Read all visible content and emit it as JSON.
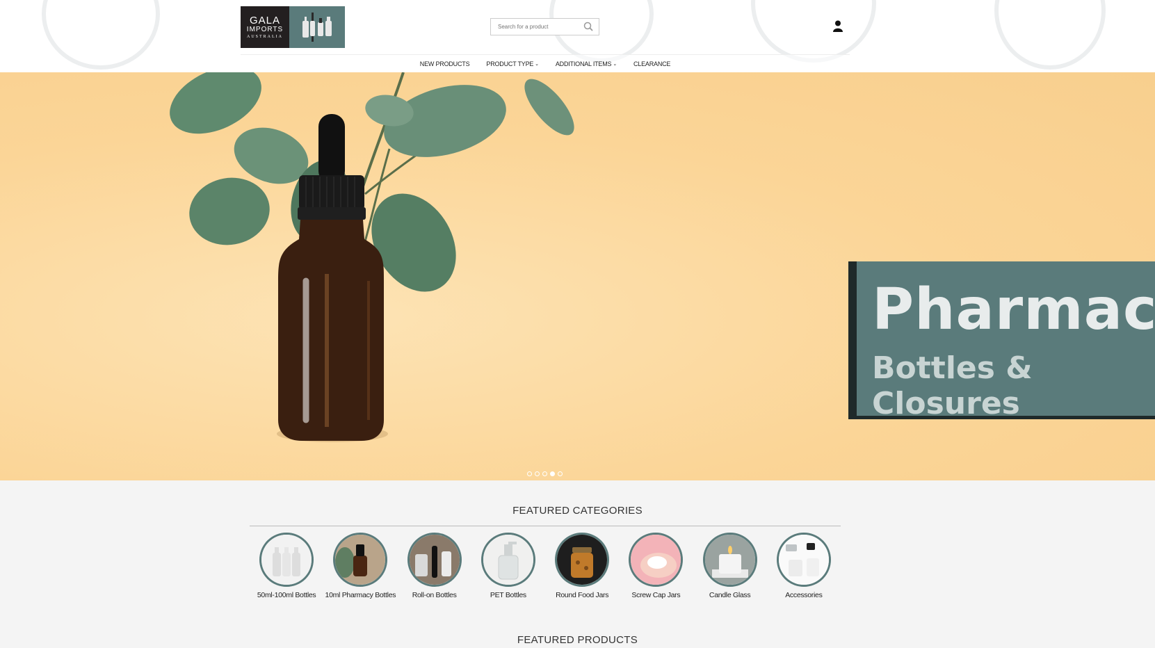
{
  "brand": {
    "line1": "GALA",
    "line2": "IMPORTS",
    "line3": "AUSTRALIA",
    "colors": {
      "dark": "#231f20",
      "teal": "#5a7b7b"
    }
  },
  "search": {
    "placeholder": "Search for a product"
  },
  "nav": {
    "items": [
      {
        "label": "NEW PRODUCTS"
      },
      {
        "label": "PRODUCT TYPE"
      },
      {
        "label": "ADDITIONAL ITEMS"
      },
      {
        "label": "CLEARANCE"
      }
    ]
  },
  "hero": {
    "title": "Pharmacy",
    "subtitle": "Bottles & Closures",
    "slides": 5,
    "active_slide": 4
  },
  "featured_categories": {
    "title": "FEATURED CATEGORIES",
    "items": [
      {
        "label": "50ml-100ml Bottles"
      },
      {
        "label": "10ml Pharmacy Bottles"
      },
      {
        "label": "Roll-on Bottles"
      },
      {
        "label": "PET Bottles"
      },
      {
        "label": "Round Food Jars"
      },
      {
        "label": "Screw Cap Jars"
      },
      {
        "label": "Candle Glass"
      },
      {
        "label": "Accessories"
      }
    ]
  },
  "featured_products": {
    "title": "FEATURED PRODUCTS"
  }
}
